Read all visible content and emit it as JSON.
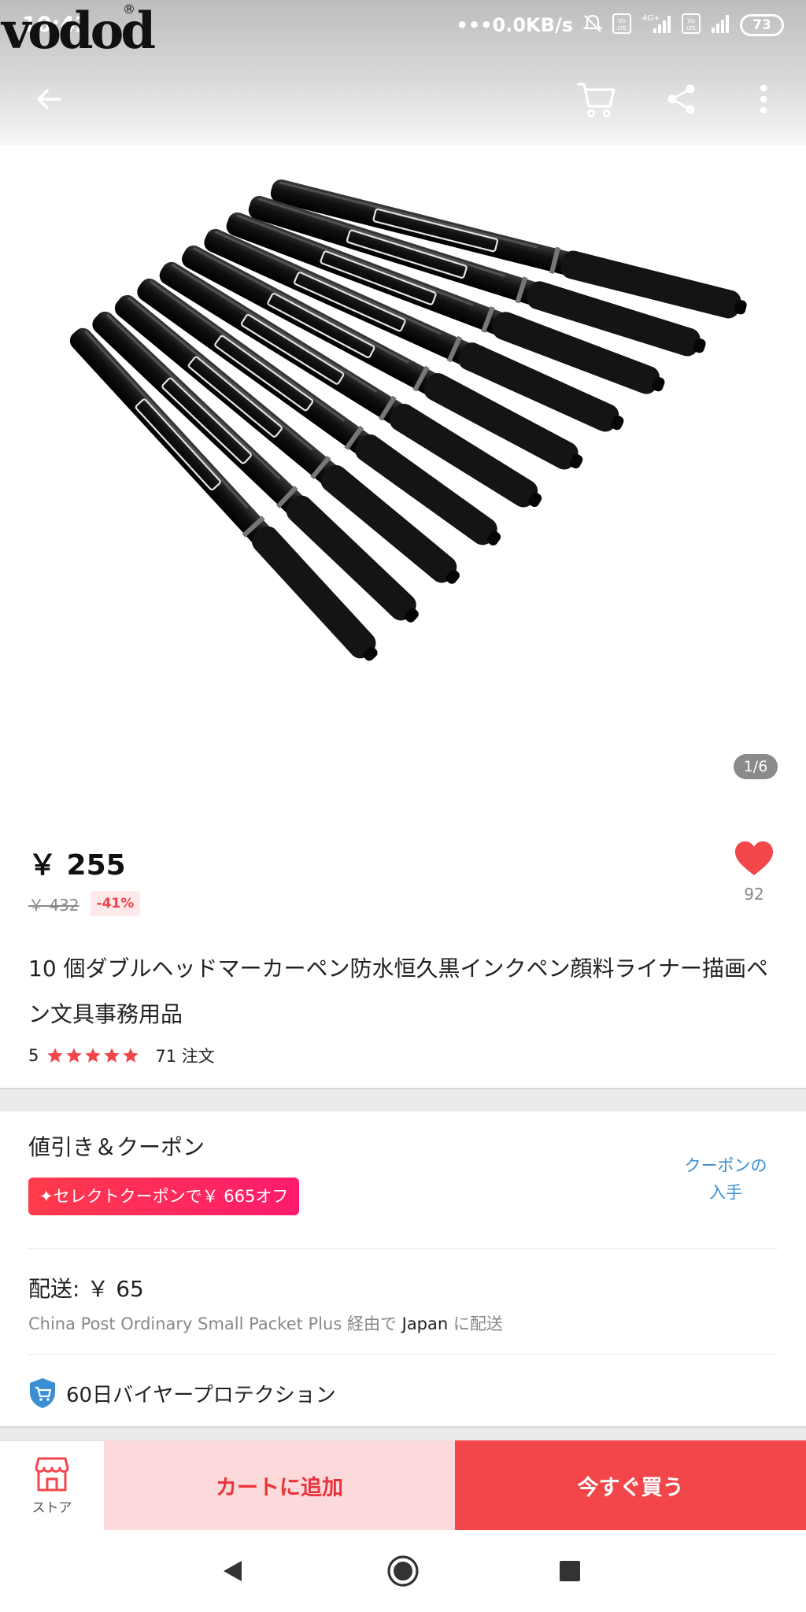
{
  "status_bar": {
    "time": "10:42",
    "logo": "vodod",
    "logo_mark": "®",
    "net_speed": "0.0KB/s",
    "battery": "73",
    "sim1_label": "Vo LTE",
    "sim2_label": "Vo LTE",
    "network_label": "4G+"
  },
  "header": {
    "back_icon": "arrow-left-icon",
    "cart_icon": "cart-icon",
    "share_icon": "share-icon",
    "more_icon": "more-vertical-icon"
  },
  "gallery": {
    "pager": "1/6"
  },
  "product": {
    "price": "￥ 255",
    "old_price": "￥ 432",
    "discount": "-41%",
    "wish_count": "92",
    "title": "10 個ダブルヘッドマーカーペン防水恒久黒インクペン顔料ライナー描画ペン文具事務用品",
    "rating": "5",
    "star_count": 5,
    "orders": "71 注文"
  },
  "coupons": {
    "title": "値引き＆クーポン",
    "pill": "✦セレクトクーポンで￥ 665オフ",
    "get_coupon_line1": "クーポンの",
    "get_coupon_line2": "入手"
  },
  "shipping": {
    "title": "配送: ￥ 65",
    "method": "China Post Ordinary Small Packet Plus 経由で ",
    "country": "Japan",
    "suffix": " に配送"
  },
  "protection": {
    "label": "60日バイヤープロテクション"
  },
  "actions": {
    "store_label": "ストア",
    "add_to_cart": "カートに追加",
    "buy_now": "今すぐ買う"
  },
  "colors": {
    "accent": "#f3464b",
    "cart_bg": "#fcd9da",
    "link": "#3a8fd4",
    "star": "#f2464b"
  }
}
